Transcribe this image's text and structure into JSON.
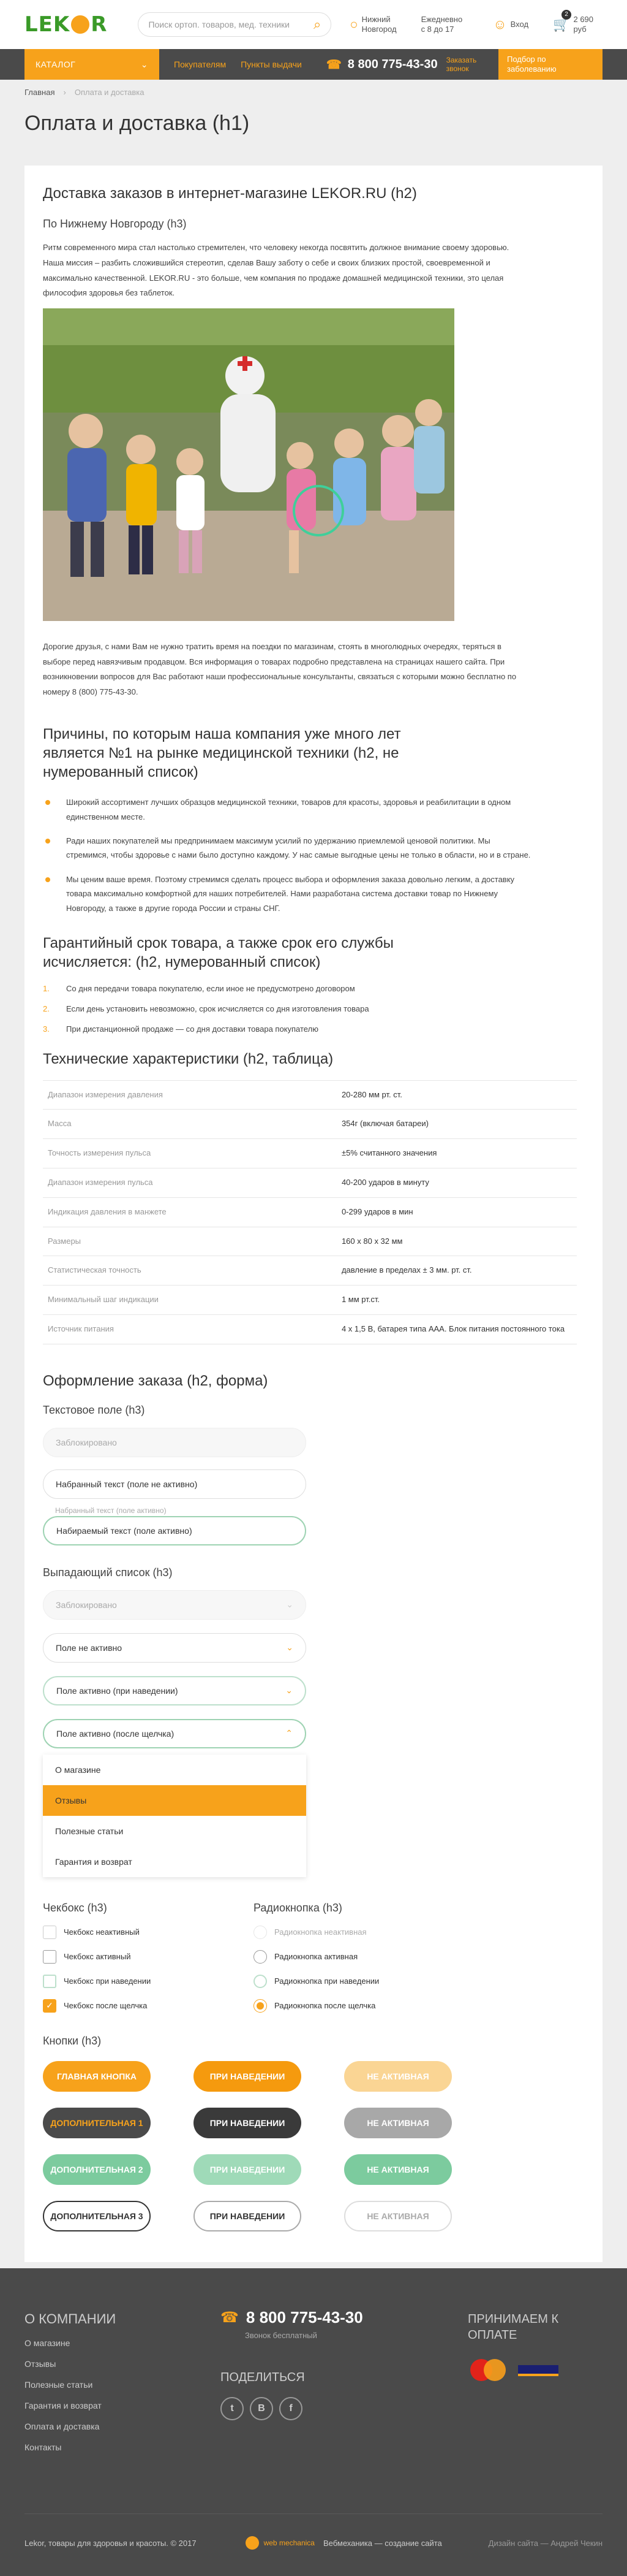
{
  "header": {
    "logo": "LEKOR",
    "search_placeholder": "Поиск ортоп. товаров, мед. техники",
    "city_line1": "Нижний",
    "city_line2": "Новгород",
    "hours_line1": "Ежедневно",
    "hours_line2": "с 8 до 17",
    "login": "Вход",
    "cart_count": "2",
    "cart_total": "2 690 руб"
  },
  "nav": {
    "catalog": "КАТАЛОГ",
    "links": [
      "Покупателям",
      "Пункты выдачи"
    ],
    "phone": "8 800 775-43-30",
    "callback": "Заказать звонок",
    "selection": "Подбор по заболеванию"
  },
  "breadcrumb": {
    "home": "Главная",
    "current": "Оплата и доставка"
  },
  "page_title": "Оплата и доставка (h1)",
  "content": {
    "h2_delivery": "Доставка заказов в интернет-магазине LEKOR.RU (h2)",
    "h3_city": "По Нижнему Новгороду (h3)",
    "intro": "Ритм современного мира стал настолько стремителен, что человеку некогда посвятить должное внимание своему здоровью. Наша миссия – разбить сложившийся стереотип, сделав Вашу заботу о себе и своих близких простой, своевременной и максимально качественной. LEKOR.RU - это больше, чем компания по продаже домашней медицинской техники, это целая философия здоровья без таблеток.",
    "para2": "Дорогие друзья, с нами Вам не нужно тратить время на поездки по магазинам, стоять в многолюдных очередях, теряться в выборе перед навязчивым продавцом. Вся информация о товарах подробно представлена на страницах нашего сайта. При возникновении вопросов для Вас работают наши профессиональные консультанты, связаться с которыми можно бесплатно по номеру 8 (800) 775-43-30.",
    "h2_reasons": "Причины, по которым наша компания уже много лет является №1 на рынке медицинской техники (h2, не нумерованный список)",
    "bullets": [
      "Широкий ассортимент лучших образцов медицинской техники, товаров для красоты, здоровья и реабилитации в одном единственном месте.",
      "Ради наших покупателей мы предпринимаем максимум усилий по удержанию приемлемой ценовой политики. Мы стремимся, чтобы здоровье с нами было доступно каждому. У нас самые выгодные цены не только в области, но и в стране.",
      "Мы ценим ваше время. Поэтому стремимся сделать процесс выбора и оформления заказа довольно легким, а доставку товара максимально комфортной для наших потребителей. Нами разработана система доставки товар по Нижнему Новгороду, а также в другие города России и страны СНГ."
    ],
    "h2_warranty": "Гарантийный срок товара, а также срок его службы исчисляется: (h2, нумерованный список)",
    "numbered": [
      {
        "n": "1.",
        "text": "Со дня передачи товара покупателю, если иное не предусмотрено договором"
      },
      {
        "n": "2.",
        "text": "Если день установить невозможно, срок исчисляется со дня изготовления товара"
      },
      {
        "n": "3.",
        "text": "При дистанционной продаже — со дня доставки товара покупателю"
      }
    ],
    "h2_specs": "Технические характеристики (h2, таблица)",
    "specs": [
      [
        "Диапазон измерения давления",
        "20-280 мм рт. ст."
      ],
      [
        "Масса",
        "354г (включая батареи)"
      ],
      [
        "Точность измерения пульса",
        "±5% считанного значения"
      ],
      [
        "Диапазон измерения пульса",
        "40-200 ударов в минуту"
      ],
      [
        "Индикация давления в манжете",
        "0-299 ударов в мин"
      ],
      [
        "Размеры",
        "160 x 80 x 32 мм"
      ],
      [
        "Статистическая точность",
        "давление в пределах ± 3 мм. рт. ст."
      ],
      [
        "Минимальный шаг индикации",
        "1 мм рт.ст."
      ],
      [
        "Источник питания",
        "4 x 1,5 В, батарея типа ААА. Блок питания постоянного тока"
      ]
    ]
  },
  "form": {
    "h2": "Оформление заказа (h2, форма)",
    "text_h3": "Текстовое поле (h3)",
    "text_disabled": "Заблокировано",
    "text_inactive": "Набранный текст (поле не активно)",
    "text_label": "Набранный текст (поле активно)",
    "text_active": "Набираемый текст (поле активно)",
    "dd_h3": "Выпадающий список (h3)",
    "dd_disabled": "Заблокировано",
    "dd_inactive": "Поле не активно",
    "dd_hover": "Поле активно (при наведении)",
    "dd_open": "Поле активно (после щелчка)",
    "dd_options": [
      "О магазине",
      "Отзывы",
      "Полезные статьи",
      "Гарантия и возврат"
    ],
    "chk_h3": "Чекбокс (h3)",
    "chk": [
      "Чекбокс неактивный",
      "Чекбокс активный",
      "Чекбокс при наведении",
      "Чекбокс после щелчка"
    ],
    "rad_h3": "Радиокнопка (h3)",
    "rad": [
      "Радиокнопка неактивная",
      "Радиокнопка активная",
      "Радиокнопка при наведении",
      "Радиокнопка после щелчка"
    ],
    "btn_h3": "Кнопки (h3)",
    "btn_main": "Главная кнопка",
    "btn_hover": "При наведении",
    "btn_disabled": "Не активная",
    "btn_add1": "Дополнительная 1",
    "btn_add2": "Дополнительная 2",
    "btn_add3": "Дополнительная 3"
  },
  "footer": {
    "about_h": "О КОМПАНИИ",
    "links": [
      "О магазине",
      "Отзывы",
      "Полезные статьи",
      "Гарантия и возврат",
      "Оплата и доставка",
      "Контакты"
    ],
    "phone": "8 800 775-43-30",
    "phone_note": "Звонок бесплатный",
    "share_h": "ПОДЕЛИТЬСЯ",
    "payment_h": "ПРИНИМАЕМ К ОПЛАТЕ",
    "copyright": "Lekor, товары для здоровья и красоты. © 2017",
    "dev_logo": "web mechanica",
    "dev_text": "Вебмеханика — создание сайта",
    "design": "Дизайн сайта — Андрей Чекин"
  }
}
